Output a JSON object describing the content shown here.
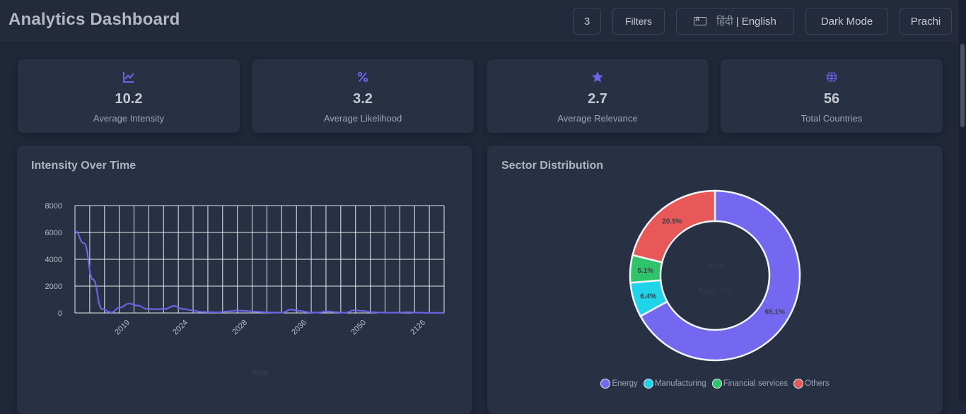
{
  "header": {
    "title": "Analytics Dashboard",
    "count_badge": "3",
    "filters_label": "Filters",
    "lang_hindi": "हिंदी",
    "lang_separator": "|",
    "lang_english": "English",
    "theme_label": "Dark Mode",
    "user_label": "Prachi"
  },
  "stats": [
    {
      "icon": "line-chart-icon",
      "value": "10.2",
      "label": "Average Intensity"
    },
    {
      "icon": "percent-icon",
      "value": "3.2",
      "label": "Average Likelihood"
    },
    {
      "icon": "star-icon",
      "value": "2.7",
      "label": "Average Relevance"
    },
    {
      "icon": "globe-icon",
      "value": "56",
      "label": "Total Countries"
    }
  ],
  "colors": {
    "accent": "#6c63e6",
    "energy": "#7467f0",
    "manufacturing": "#1fd3e8",
    "financial": "#2fc46a",
    "others": "#e85858"
  },
  "panels": {
    "intensity_title": "Intensity Over Time",
    "sector_title": "Sector Distribution"
  },
  "chart_data": [
    {
      "type": "line",
      "title": "Intensity Over Time",
      "xlabel": "Year",
      "ylabel": "",
      "ylim": [
        0,
        8000
      ],
      "y_ticks": [
        "8000",
        "6000",
        "4000",
        "2000",
        "0"
      ],
      "x_tick_labels": [
        "2019",
        "2024",
        "2028",
        "2036",
        "2050",
        "2126"
      ],
      "grid": true,
      "series": [
        {
          "values": [
            6100,
            5200,
            2500,
            300,
            50,
            400,
            700,
            550,
            300,
            280,
            300,
            520,
            300,
            200,
            80,
            60,
            50,
            120,
            180,
            150,
            100,
            60,
            40,
            30,
            250,
            150,
            50,
            30,
            120,
            60,
            20,
            200,
            150,
            60,
            30,
            20,
            40,
            60,
            30,
            10,
            10,
            10
          ]
        }
      ]
    },
    {
      "type": "pie",
      "title": "Sector Distribution",
      "center_label": "Total",
      "center_total": "Total: 771",
      "legend_position": "bottom",
      "slices": [
        {
          "name": "Energy",
          "value": 65.1,
          "label": "65.1%",
          "color": "#7467f0"
        },
        {
          "name": "Manufacturing",
          "value": 6.4,
          "label": "6.4%",
          "color": "#1fd3e8"
        },
        {
          "name": "Financial services",
          "value": 5.1,
          "label": "5.1%",
          "color": "#2fc46a"
        },
        {
          "name": "Others",
          "value": 20.5,
          "label": "20.5%",
          "color": "#e85858"
        }
      ]
    }
  ]
}
